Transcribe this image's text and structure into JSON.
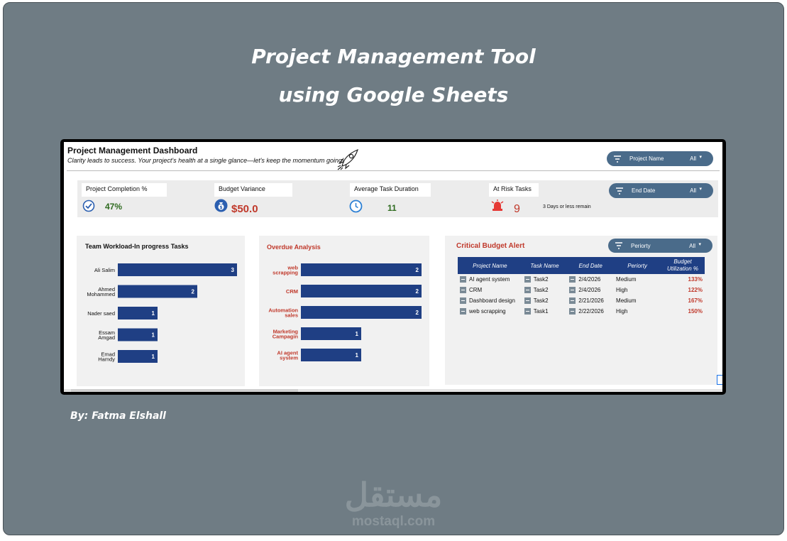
{
  "slide": {
    "title_line1": "Project Management Tool",
    "title_line2": "using Google Sheets",
    "author": "By: Fatma Elshall",
    "watermark_arabic": "مستقل",
    "watermark_url": "mostaql.com"
  },
  "dashboard": {
    "title": "Project Management Dashboard",
    "subtitle": "Clarity leads to success. Your project's health at a single glance—let's keep the momentum going!",
    "icon": "rocket-icon"
  },
  "filters": {
    "project_name": {
      "label": "Project Name",
      "value": "All",
      "caret": "▾"
    },
    "end_date": {
      "label": "End Date",
      "value": "All",
      "caret": "▾"
    },
    "periorty": {
      "label": "Periorty",
      "value": "All",
      "caret": "▾"
    }
  },
  "kpis": {
    "completion": {
      "label": "Project Completion %",
      "value": "47%",
      "icon": "check-circle-icon",
      "color": "#2e6b1f"
    },
    "budget": {
      "label": "Budget Variance",
      "value": "$50.0",
      "icon": "money-bag-icon",
      "color": "#c0392b"
    },
    "duration": {
      "label": "Average Task Duration",
      "value": "11",
      "icon": "clock-icon",
      "color": "#2e6b1f"
    },
    "risk": {
      "label": "At Risk Tasks",
      "value": "9",
      "note": "3 Days or less remain",
      "icon": "alarm-icon",
      "color": "#c0392b"
    }
  },
  "team_workload": {
    "title": "Team Workload-In progress Tasks",
    "bar_color": "#1f3f84",
    "labels": [
      [
        "Ali Salim"
      ],
      [
        "Ahmed",
        "Mohammed"
      ],
      [
        "Nader saed"
      ],
      [
        "Essam",
        "Amgad"
      ],
      [
        "Emad",
        "Hamdy"
      ]
    ]
  },
  "overdue": {
    "title": "Overdue Analysis",
    "title_color": "#c0392b",
    "labels": [
      [
        "web",
        "scrapping"
      ],
      [
        "CRM"
      ],
      [
        "Automation",
        "sales"
      ],
      [
        "Marketing",
        "Campagin"
      ],
      [
        "AI agent",
        "system"
      ]
    ]
  },
  "critical_budget": {
    "title": "Critical Budget Alert",
    "columns": [
      "Project Name",
      "Task Name",
      "End Date",
      "Periorty",
      "Budget Utilization %"
    ],
    "rows": [
      {
        "project": "AI agent system",
        "task": "Task2",
        "end": "2/4/2026",
        "priority": "Medium",
        "util": "133%"
      },
      {
        "project": "CRM",
        "task": "Task2",
        "end": "2/4/2026",
        "priority": "High",
        "util": "122%"
      },
      {
        "project": "Dashboard design",
        "task": "Task2",
        "end": "2/21/2026",
        "priority": "Medium",
        "util": "167%"
      },
      {
        "project": "web scrapping",
        "task": "Task1",
        "end": "2/22/2026",
        "priority": "High",
        "util": "150%"
      }
    ]
  },
  "chart_data": [
    {
      "type": "bar",
      "orientation": "horizontal",
      "title": "Team Workload-In progress Tasks",
      "categories": [
        "Ali Salim",
        "Ahmed Mohammed",
        "Nader saed",
        "Essam Amgad",
        "Emad Hamdy"
      ],
      "values": [
        3,
        2,
        1,
        1,
        1
      ],
      "xlim": [
        0,
        3
      ]
    },
    {
      "type": "bar",
      "orientation": "horizontal",
      "title": "Overdue Analysis",
      "categories": [
        "web scrapping",
        "CRM",
        "Automation sales",
        "Marketing Campagin",
        "AI agent system"
      ],
      "values": [
        2,
        2,
        2,
        1,
        1
      ],
      "xlim": [
        0,
        2
      ]
    }
  ]
}
